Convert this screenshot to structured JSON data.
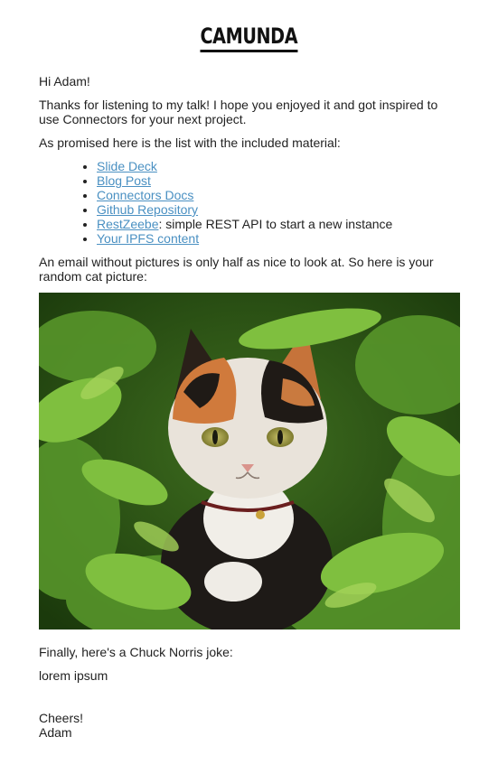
{
  "header": {
    "logo_text": "CAMUNDA"
  },
  "greeting": "Hi Adam!",
  "intro": "Thanks for listening to my talk! I hope you enjoyed it and got inspired to use Connectors for your next project.",
  "promise": "As promised here is the list with the included material:",
  "materials": [
    {
      "link": "Slide Deck",
      "suffix": ""
    },
    {
      "link": "Blog Post",
      "suffix": ""
    },
    {
      "link": "Connectors Docs",
      "suffix": ""
    },
    {
      "link": "Github Repository",
      "suffix": ""
    },
    {
      "link": "RestZeebe",
      "suffix": ": simple REST API to start a new instance"
    },
    {
      "link": "Your IPFS content",
      "suffix": ""
    }
  ],
  "picture_intro": "An email without pictures is only half as nice to look at. So here is your random cat picture:",
  "joke_intro": "Finally, here's a Chuck Norris joke:",
  "joke": "lorem ipsum",
  "signoff": "Cheers!",
  "signature": "Adam",
  "colors": {
    "link": "#4a90c2",
    "text": "#222222"
  }
}
